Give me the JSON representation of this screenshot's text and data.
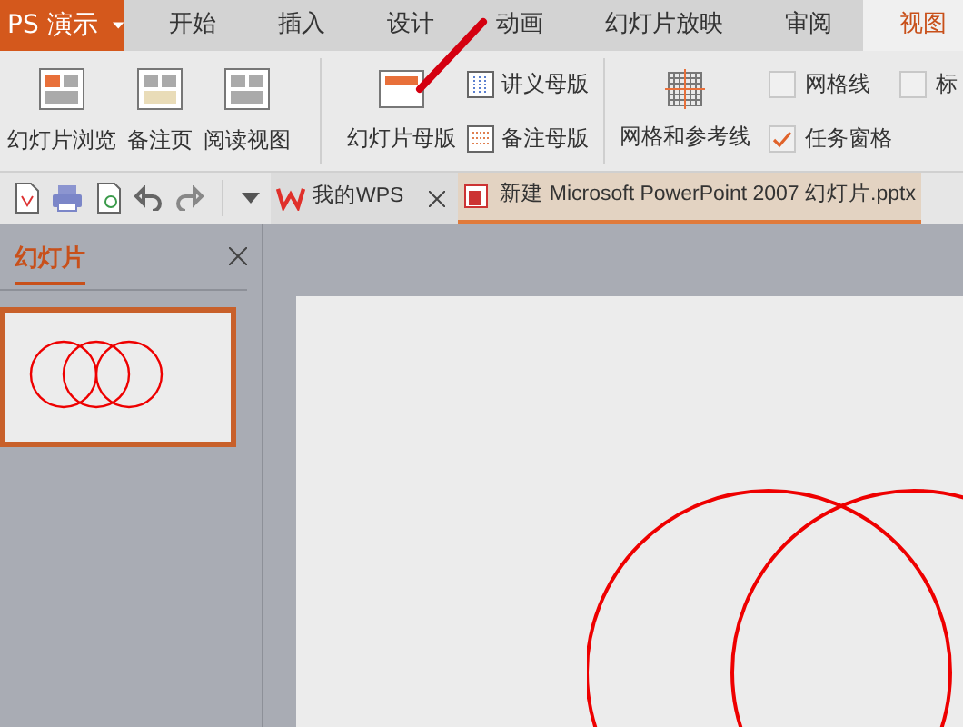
{
  "app_button": {
    "label": "PS 演示"
  },
  "tabs": [
    {
      "label": "开始",
      "selected": false
    },
    {
      "label": "插入",
      "selected": false
    },
    {
      "label": "设计",
      "selected": false
    },
    {
      "label": "动画",
      "selected": false
    },
    {
      "label": "幻灯片放映",
      "selected": false
    },
    {
      "label": "审阅",
      "selected": false
    },
    {
      "label": "视图",
      "selected": true
    }
  ],
  "ribbon": {
    "view_buttons": [
      "幻灯片浏览",
      "备注页",
      "阅读视图"
    ],
    "master_large": "幻灯片母版",
    "master_small": [
      "讲义母版",
      "备注母版"
    ],
    "grid_button": "网格和参考线",
    "checkboxes": [
      {
        "label": "网格线",
        "checked": false
      },
      {
        "label": "任务窗格",
        "checked": true
      }
    ],
    "cut_checkbox": {
      "label": "标",
      "checked": false
    }
  },
  "doc_tabs": [
    {
      "label": "我的WPS",
      "selected": false,
      "closable": true
    },
    {
      "label": "新建 Microsoft PowerPoint 2007 幻灯片.pptx",
      "selected": true,
      "closable": false
    }
  ],
  "side_pane": {
    "title": "幻灯片"
  }
}
